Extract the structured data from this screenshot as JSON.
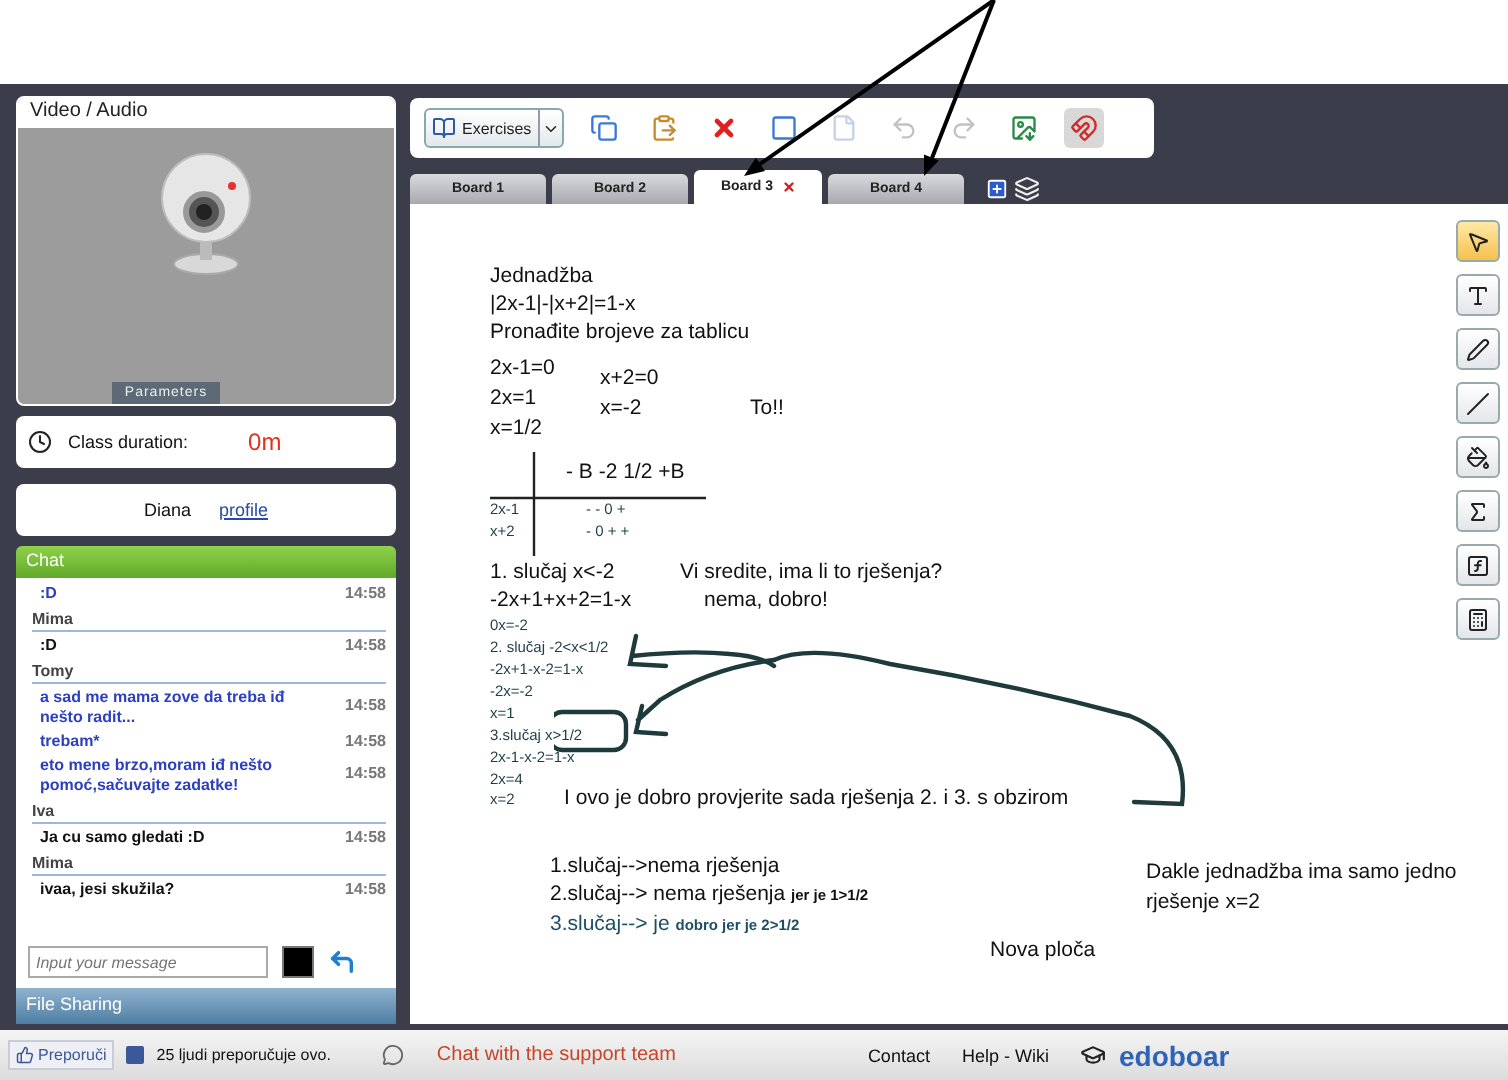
{
  "video_panel": {
    "title": "Video / Audio",
    "button": "Parameters"
  },
  "class_duration": {
    "label": "Class duration:",
    "value": "0m"
  },
  "user": {
    "name": "Diana",
    "link": "profile"
  },
  "chat": {
    "title": "Chat",
    "entries": [
      {
        "kind": "message",
        "text": ":D",
        "time": "14:58",
        "color": "#2b3fbf"
      },
      {
        "kind": "author",
        "name": "Mima"
      },
      {
        "kind": "message",
        "text": ":D",
        "time": "14:58",
        "color": "#111111"
      },
      {
        "kind": "author",
        "name": "Tomy"
      },
      {
        "kind": "message",
        "text": "a sad me mama zove da treba iđ nešto radit...",
        "time": "14:58",
        "color": "#2b3fbf"
      },
      {
        "kind": "message",
        "text": "trebam*",
        "time": "14:58",
        "color": "#2b3fbf"
      },
      {
        "kind": "message",
        "text": "eto mene brzo,moram iđ nešto pomoć,sačuvajte zadatke!",
        "time": "14:58",
        "color": "#2b3fbf"
      },
      {
        "kind": "author",
        "name": "Iva"
      },
      {
        "kind": "message",
        "text": "Ja cu samo gledati :D",
        "time": "14:58",
        "color": "#111111"
      },
      {
        "kind": "author",
        "name": "Mima"
      },
      {
        "kind": "message",
        "text": "ivaa, jesi skužila?",
        "time": "14:58",
        "color": "#111111"
      }
    ],
    "input": {
      "placeholder": "Input your message"
    }
  },
  "file_sharing": {
    "title": "File Sharing"
  },
  "toolbar": {
    "dropdown": "Exercises",
    "tools": [
      {
        "kind": "copy",
        "disabled": false,
        "pressed": false
      },
      {
        "kind": "paste",
        "disabled": false,
        "pressed": false
      },
      {
        "kind": "delete",
        "disabled": false,
        "pressed": false
      },
      {
        "kind": "board",
        "disabled": false,
        "pressed": false
      },
      {
        "kind": "page",
        "disabled": true,
        "pressed": false
      },
      {
        "kind": "undo",
        "disabled": true,
        "pressed": false
      },
      {
        "kind": "redo",
        "disabled": true,
        "pressed": false
      },
      {
        "kind": "export",
        "disabled": false,
        "pressed": false
      },
      {
        "kind": "magnet",
        "disabled": false,
        "pressed": true
      }
    ]
  },
  "tabs": [
    {
      "label": "Board 1",
      "selected": false
    },
    {
      "label": "Board 2",
      "selected": false
    },
    {
      "label": "Board 3",
      "selected": true
    },
    {
      "label": "Board 4",
      "selected": false
    }
  ],
  "whiteboard": {
    "items": [
      {
        "kind": "text",
        "text": "Jednadžba"
      },
      {
        "kind": "text",
        "text": "|2x-1|-|x+2|=1-x"
      },
      {
        "kind": "text",
        "text": "Pronađite brojeve za tablicu"
      },
      {
        "kind": "text",
        "text": "2x-1=0"
      },
      {
        "kind": "text",
        "text": "2x=1"
      },
      {
        "kind": "text",
        "text": "x=1/2"
      },
      {
        "kind": "text",
        "text": "x+2=0"
      },
      {
        "kind": "text",
        "text": "x=-2"
      },
      {
        "kind": "text",
        "text": "To!!"
      },
      {
        "kind": "table",
        "text": "- B  -2   1/2 +B"
      },
      {
        "kind": "small",
        "text": "2x-1"
      },
      {
        "kind": "small",
        "text": "-      -   0  +"
      },
      {
        "kind": "small",
        "text": "x+2"
      },
      {
        "kind": "small",
        "text": "-   0 +      +"
      },
      {
        "kind": "text",
        "text": "1. slučaj x<-2"
      },
      {
        "kind": "text",
        "text": "Vi sredite, ima li to rješenja?"
      },
      {
        "kind": "text",
        "text": "-2x+1+x+2=1-x"
      },
      {
        "kind": "text",
        "text": "nema, dobro!"
      },
      {
        "kind": "small",
        "text": "0x=-2"
      },
      {
        "kind": "small",
        "text": "2. slučaj -2<x<1/2"
      },
      {
        "kind": "small",
        "text": "-2x+1-x-2=1-x"
      },
      {
        "kind": "small",
        "text": "-2x=-2"
      },
      {
        "kind": "small",
        "text": "x=1"
      },
      {
        "kind": "small",
        "text": "3.slučaj x>1/2"
      },
      {
        "kind": "small",
        "text": "2x-1-x-2=1-x"
      },
      {
        "kind": "small",
        "text": "2x=4"
      },
      {
        "kind": "small",
        "text": "x=2"
      },
      {
        "kind": "text",
        "text": "I ovo je dobro provjerite sada rješenja 2. i 3. s obzirom"
      },
      {
        "kind": "text",
        "text": "1.slučaj-->nema rješenja"
      },
      {
        "kind": "text",
        "text": "2.slučaj--> nema rješenja **jer je 1>1/2**"
      },
      {
        "kind": "teal",
        "text": "3.slučaj--> je **dobro jer je 2>1/2**"
      },
      {
        "kind": "text",
        "text": "Dakle jednadžba ima samo jedno"
      },
      {
        "kind": "text",
        "text": "rješenje x=2"
      },
      {
        "kind": "text",
        "text": "Nova ploča"
      }
    ],
    "tools": [
      {
        "kind": "pointer",
        "selected": true
      },
      {
        "kind": "text",
        "selected": false
      },
      {
        "kind": "pen",
        "selected": false
      },
      {
        "kind": "line",
        "selected": false
      },
      {
        "kind": "fill",
        "selected": false
      },
      {
        "kind": "sigma",
        "selected": false
      },
      {
        "kind": "function",
        "selected": false
      },
      {
        "kind": "calculator",
        "selected": false
      }
    ]
  },
  "footer": {
    "like_button": "Preporuči",
    "likes": "25 ljudi preporučuje ovo.",
    "support_link": "Chat with the support team",
    "links": [
      "Contact",
      "Help - Wiki"
    ],
    "logo": "edoboar"
  }
}
